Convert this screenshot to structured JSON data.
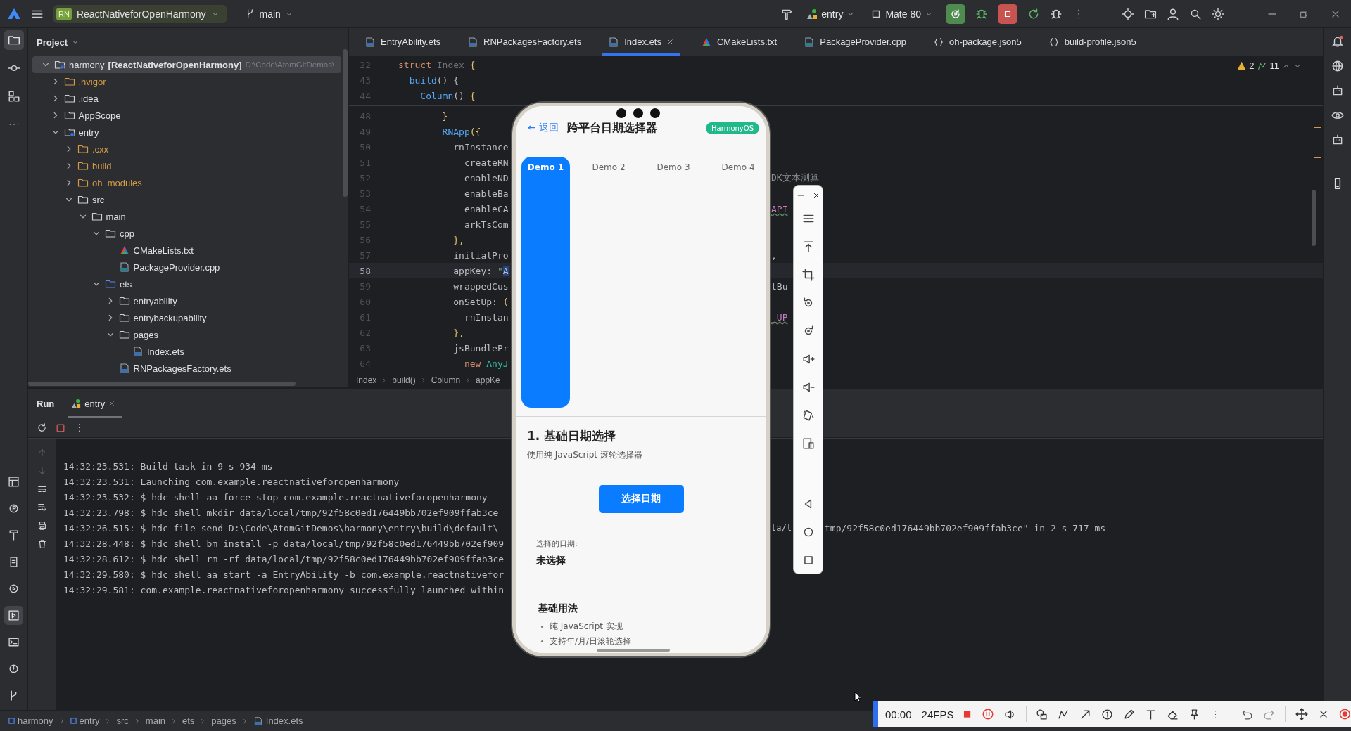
{
  "title_bar": {
    "project_badge": "RN",
    "project": "ReactNativeforOpenHarmony",
    "branch": "main",
    "run_config": "entry",
    "device": "Mate 80"
  },
  "project_panel": {
    "title": "Project",
    "tree": [
      {
        "name": "harmony",
        "qualifier": "[ReactNativeforOpenHarmony]",
        "path": "D:\\Code\\AtomGitDemos\\",
        "kind": "module",
        "expanded": true,
        "excluded": false,
        "selected": true,
        "children": [
          {
            "name": ".hvigor",
            "kind": "folder",
            "expanded": false,
            "excluded": true,
            "selected": false
          },
          {
            "name": ".idea",
            "kind": "folder",
            "expanded": false,
            "excluded": false,
            "selected": false
          },
          {
            "name": "AppScope",
            "kind": "folder",
            "expanded": false,
            "excluded": false,
            "selected": false
          },
          {
            "name": "entry",
            "kind": "module",
            "expanded": true,
            "excluded": false,
            "selected": false,
            "children": [
              {
                "name": ".cxx",
                "kind": "folder",
                "expanded": false,
                "excluded": true,
                "selected": false
              },
              {
                "name": "build",
                "kind": "folder",
                "expanded": false,
                "excluded": true,
                "selected": false
              },
              {
                "name": "oh_modules",
                "kind": "folder",
                "expanded": false,
                "excluded": true,
                "selected": false
              },
              {
                "name": "src",
                "kind": "folder",
                "expanded": true,
                "excluded": false,
                "selected": false,
                "children": [
                  {
                    "name": "main",
                    "kind": "folder",
                    "expanded": true,
                    "excluded": false,
                    "selected": false,
                    "children": [
                      {
                        "name": "cpp",
                        "kind": "folder",
                        "expanded": true,
                        "excluded": false,
                        "selected": false,
                        "children": [
                          {
                            "name": "CMakeLists.txt",
                            "kind": "cmake",
                            "selected": false
                          },
                          {
                            "name": "PackageProvider.cpp",
                            "kind": "cpp",
                            "selected": false
                          }
                        ]
                      },
                      {
                        "name": "ets",
                        "kind": "source_folder",
                        "expanded": true,
                        "excluded": false,
                        "selected": false,
                        "children": [
                          {
                            "name": "entryability",
                            "kind": "folder",
                            "expanded": false,
                            "excluded": false,
                            "selected": false
                          },
                          {
                            "name": "entrybackupability",
                            "kind": "folder",
                            "expanded": false,
                            "excluded": false,
                            "selected": false
                          },
                          {
                            "name": "pages",
                            "kind": "folder",
                            "expanded": true,
                            "excluded": false,
                            "selected": false,
                            "children": [
                              {
                                "name": "Index.ets",
                                "kind": "ets",
                                "selected": false
                              }
                            ]
                          },
                          {
                            "name": "RNPackagesFactory.ets",
                            "kind": "ets",
                            "selected": false
                          }
                        ]
                      }
                    ]
                  }
                ]
              }
            ]
          }
        ]
      }
    ]
  },
  "editor": {
    "tabs": [
      {
        "label": "EntryAbility.ets",
        "kind": "ets",
        "selected": false
      },
      {
        "label": "RNPackagesFactory.ets",
        "kind": "ets",
        "selected": false
      },
      {
        "label": "Index.ets",
        "kind": "ets",
        "selected": true
      },
      {
        "label": "CMakeLists.txt",
        "kind": "cmake",
        "selected": false
      },
      {
        "label": "PackageProvider.cpp",
        "kind": "cpp",
        "selected": false
      },
      {
        "label": "oh-package.json5",
        "kind": "json",
        "selected": false
      },
      {
        "label": "build-profile.json5",
        "kind": "json",
        "selected": false
      }
    ],
    "inspections": {
      "warnings": "2",
      "checks": "11"
    },
    "lines": [
      {
        "number": "22",
        "sticky": true,
        "current": false,
        "segments": [
          {
            "text": "struct ",
            "kind": "keyword"
          },
          {
            "text": "Index ",
            "kind": "type"
          },
          {
            "text": "{",
            "kind": "brace"
          }
        ]
      },
      {
        "number": "43",
        "sticky": true,
        "current": false,
        "segments": [
          {
            "text": "  build",
            "kind": "fn"
          },
          {
            "text": "() {",
            "kind": "plain"
          }
        ]
      },
      {
        "number": "44",
        "sticky": true,
        "current": false,
        "segments": [
          {
            "text": "    Column",
            "kind": "fn"
          },
          {
            "text": "() ",
            "kind": "plain"
          },
          {
            "text": "{",
            "kind": "brace"
          }
        ]
      },
      {
        "number": "48",
        "sticky": false,
        "current": false,
        "segments": [
          {
            "text": "        }",
            "kind": "brace"
          }
        ]
      },
      {
        "number": "49",
        "sticky": false,
        "current": false,
        "segments": [
          {
            "text": "        RNApp",
            "kind": "fn"
          },
          {
            "text": "({",
            "kind": "brace"
          }
        ]
      },
      {
        "number": "50",
        "sticky": false,
        "current": false,
        "segments": [
          {
            "text": "          rnInstance",
            "kind": "plain"
          }
        ]
      },
      {
        "number": "51",
        "sticky": false,
        "current": false,
        "segments": [
          {
            "text": "            createRN",
            "kind": "plain"
          }
        ]
      },
      {
        "number": "52",
        "sticky": false,
        "current": false,
        "segments": [
          {
            "text": "            enableND",
            "kind": "plain"
          }
        ],
        "tail": {
          "text": "DK文本测算",
          "kind": "hint"
        }
      },
      {
        "number": "53",
        "sticky": false,
        "current": false,
        "segments": [
          {
            "text": "            enableBa",
            "kind": "plain"
          }
        ]
      },
      {
        "number": "54",
        "sticky": false,
        "current": false,
        "segments": [
          {
            "text": "            enableCA",
            "kind": "plain"
          }
        ],
        "tail": {
          "text": "API",
          "kind": "field"
        }
      },
      {
        "number": "55",
        "sticky": false,
        "current": false,
        "segments": [
          {
            "text": "            arkTsCom",
            "kind": "plain"
          }
        ]
      },
      {
        "number": "56",
        "sticky": false,
        "current": false,
        "segments": [
          {
            "text": "          },",
            "kind": "brace"
          }
        ]
      },
      {
        "number": "57",
        "sticky": false,
        "current": false,
        "segments": [
          {
            "text": "          initialPro",
            "kind": "plain"
          }
        ],
        "tail": {
          "text": ",",
          "kind": "plain"
        }
      },
      {
        "number": "58",
        "sticky": false,
        "current": true,
        "segments": [
          {
            "text": "          appKey: ",
            "kind": "plain"
          },
          {
            "text": "\"",
            "kind": "string"
          },
          {
            "text": "A",
            "kind": "selection"
          }
        ]
      },
      {
        "number": "59",
        "sticky": false,
        "current": false,
        "segments": [
          {
            "text": "          wrappedCus",
            "kind": "plain"
          }
        ],
        "tail": {
          "text": "tBu",
          "kind": "plain"
        }
      },
      {
        "number": "60",
        "sticky": false,
        "current": false,
        "segments": [
          {
            "text": "          onSetUp: ",
            "kind": "plain"
          },
          {
            "text": "(",
            "kind": "brace"
          }
        ]
      },
      {
        "number": "61",
        "sticky": false,
        "current": false,
        "segments": [
          {
            "text": "            rnInstan",
            "kind": "plain"
          }
        ],
        "tail": {
          "text": "_UP",
          "kind": "field"
        }
      },
      {
        "number": "62",
        "sticky": false,
        "current": false,
        "segments": [
          {
            "text": "          },",
            "kind": "brace"
          }
        ]
      },
      {
        "number": "63",
        "sticky": false,
        "current": false,
        "segments": [
          {
            "text": "          jsBundlePr",
            "kind": "plain"
          }
        ]
      },
      {
        "number": "64",
        "sticky": false,
        "current": false,
        "segments": [
          {
            "text": "            new ",
            "kind": "keyword"
          },
          {
            "text": "AnyJ",
            "kind": "class"
          }
        ]
      }
    ],
    "breadcrumb": [
      "Index",
      "build()",
      "Column",
      "appKe"
    ]
  },
  "run_panel": {
    "title": "Run",
    "tabs": [
      {
        "label": "entry",
        "selected": true
      }
    ],
    "console": [
      {
        "text": "14:32:23.531: Build task in 9 s 934 ms"
      },
      {
        "text": "14:32:23.531: Launching com.example.reactnativeforopenharmony"
      },
      {
        "text": "14:32:23.532: $ hdc shell aa force-stop com.example.reactnativeforopenharmony"
      },
      {
        "text": "14:32:23.798: $ hdc shell mkdir data/local/tmp/92f58c0ed176449bb702ef909ffab3ce"
      },
      {
        "text": "14:32:26.515: $ hdc file send D:\\Code\\AtomGitDemos\\harmony\\entry\\build\\default\\",
        "tails": [
          "ta/l",
          "tmp/92f58c0ed176449bb702ef909ffab3ce\" in 2 s 717 ms"
        ]
      },
      {
        "text": "14:32:28.448: $ hdc shell bm install -p data/local/tmp/92f58c0ed176449bb702ef909"
      },
      {
        "text": "14:32:28.612: $ hdc shell rm -rf data/local/tmp/92f58c0ed176449bb702ef909ffab3ce"
      },
      {
        "text": "14:32:29.580: $ hdc shell aa start -a EntryAbility -b com.example.reactnativefor"
      },
      {
        "text": "14:32:29.581: com.example.reactnativeforopenharmony successfully launched within"
      }
    ]
  },
  "status_bar": {
    "breadcrumb": [
      {
        "label": "harmony",
        "kind": "module"
      },
      {
        "label": "entry",
        "kind": "module"
      },
      {
        "label": "src",
        "kind": "folder"
      },
      {
        "label": "main",
        "kind": "folder"
      },
      {
        "label": "ets",
        "kind": "folder"
      },
      {
        "label": "pages",
        "kind": "folder"
      },
      {
        "label": "Index.ets",
        "kind": "ets"
      }
    ]
  },
  "phone": {
    "back": "← 返回",
    "title": "跨平台日期选择器",
    "badge": "HarmonyOS",
    "tabs": [
      {
        "label": "Demo 1",
        "selected": true
      },
      {
        "label": "Demo 2",
        "selected": false
      },
      {
        "label": "Demo 3",
        "selected": false
      },
      {
        "label": "Demo 4",
        "selected": false
      }
    ],
    "section_title": "1. 基础日期选择",
    "section_subtitle": "使用纯 JavaScript 滚轮选择器",
    "button": "选择日期",
    "selected_label": "选择的日期:",
    "selected_value": "未选择",
    "usage_title": "基础用法",
    "usage_items": [
      "纯 JavaScript 实现",
      "支持年/月/日滚轮选择"
    ]
  },
  "recorder": {
    "time": "00:00",
    "fps": "24FPS"
  }
}
